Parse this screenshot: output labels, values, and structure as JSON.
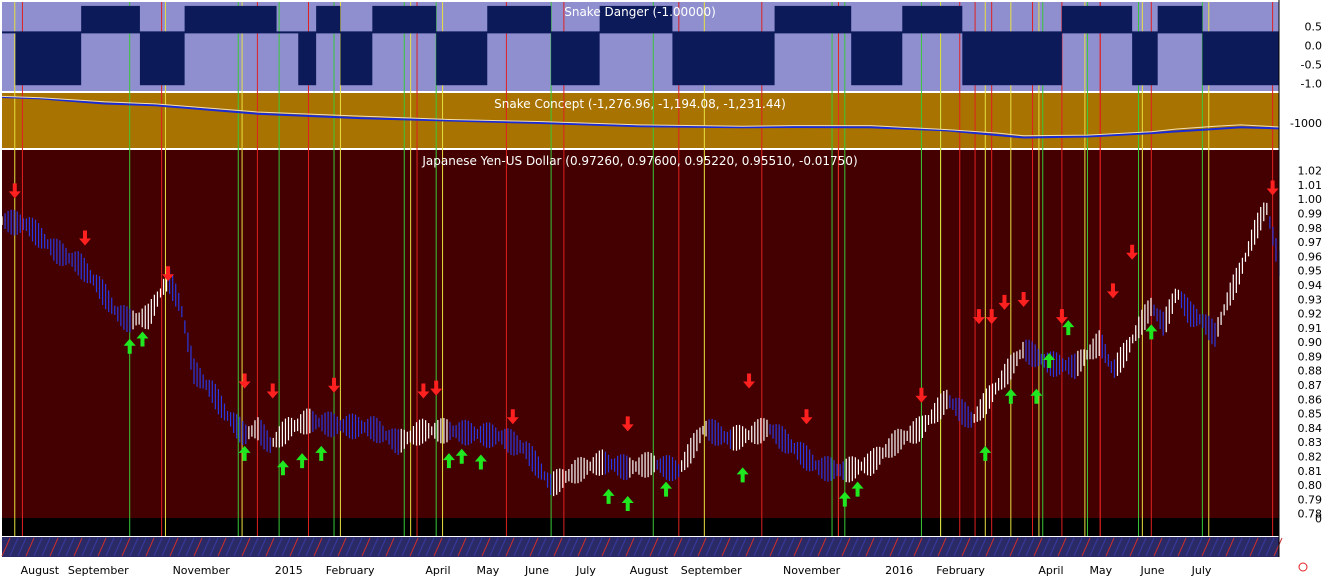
{
  "colors": {
    "danger_bg": "#8f8fd0",
    "danger_dark": "#0c1a5a",
    "concept_bg": "#a87300",
    "concept_line": "#1a2bd6",
    "concept_line2": "#f4e0b0",
    "price_bg": "#440000",
    "price_up": "#ffffff",
    "price_mid": "#2a38e0",
    "vline_green": "#38c838",
    "vline_yellow": "#e8e040",
    "vline_red": "#e02020",
    "arrow_up": "#20e820",
    "arrow_down": "#ff2020"
  },
  "chart_data": [
    {
      "type": "line",
      "title": "Snake Danger (-1.00000)",
      "ylim": [
        -1.15,
        1.1
      ],
      "ticks": [
        "0.5",
        "0.0",
        "-0.5",
        "-1.0"
      ],
      "tick_values": [
        0.5,
        0.0,
        -0.5,
        -1.0
      ],
      "states": [
        {
          "from": 0.0,
          "to": 0.0105,
          "value": 0
        },
        {
          "from": 0.0105,
          "to": 0.062,
          "value": -1
        },
        {
          "from": 0.062,
          "to": 0.108,
          "value": 1
        },
        {
          "from": 0.108,
          "to": 0.143,
          "value": -1
        },
        {
          "from": 0.143,
          "to": 0.215,
          "value": 1
        },
        {
          "from": 0.215,
          "to": 0.232,
          "value": 0
        },
        {
          "from": 0.232,
          "to": 0.246,
          "value": -1
        },
        {
          "from": 0.246,
          "to": 0.265,
          "value": 1
        },
        {
          "from": 0.265,
          "to": 0.29,
          "value": -1
        },
        {
          "from": 0.29,
          "to": 0.34,
          "value": 1
        },
        {
          "from": 0.34,
          "to": 0.38,
          "value": -1
        },
        {
          "from": 0.38,
          "to": 0.43,
          "value": 1
        },
        {
          "from": 0.43,
          "to": 0.468,
          "value": -1
        },
        {
          "from": 0.468,
          "to": 0.525,
          "value": 1
        },
        {
          "from": 0.525,
          "to": 0.605,
          "value": -1
        },
        {
          "from": 0.605,
          "to": 0.665,
          "value": 1
        },
        {
          "from": 0.665,
          "to": 0.705,
          "value": -1
        },
        {
          "from": 0.705,
          "to": 0.752,
          "value": 1
        },
        {
          "from": 0.752,
          "to": 0.83,
          "value": -1
        },
        {
          "from": 0.83,
          "to": 0.885,
          "value": 1
        },
        {
          "from": 0.885,
          "to": 0.905,
          "value": -1
        },
        {
          "from": 0.905,
          "to": 0.94,
          "value": 1
        },
        {
          "from": 0.94,
          "to": 1.0,
          "value": -1
        }
      ]
    },
    {
      "type": "line",
      "title": "Snake Concept (-1,276.96, -1,194.08, -1,231.44)",
      "ylim": [
        -1300,
        -1150
      ],
      "ticks": [
        "-1000"
      ],
      "tick_values": [
        -1232
      ],
      "x": [
        0,
        0.03,
        0.08,
        0.12,
        0.2,
        0.28,
        0.35,
        0.42,
        0.5,
        0.58,
        0.62,
        0.68,
        0.74,
        0.78,
        0.8,
        0.85,
        0.9,
        0.92,
        0.95,
        0.97,
        1.0
      ],
      "series": [
        {
          "values": [
            -1156,
            -1160,
            -1175,
            -1180,
            -1205,
            -1218,
            -1225,
            -1232,
            -1242,
            -1245,
            -1244,
            -1245,
            -1254,
            -1268,
            -1275,
            -1272,
            -1262,
            -1257,
            -1250,
            -1245,
            -1248
          ]
        },
        {
          "values": [
            -1154,
            -1158,
            -1170,
            -1176,
            -1200,
            -1212,
            -1222,
            -1228,
            -1238,
            -1242,
            -1240,
            -1240,
            -1252,
            -1262,
            -1270,
            -1268,
            -1258,
            -1250,
            -1242,
            -1238,
            -1244
          ]
        }
      ]
    },
    {
      "type": "line",
      "title": "Japanese Yen-US Dollar (0.97260, 0.97600, 0.95220, 0.95510, -0.01750)",
      "ylim": [
        0.77,
        1.026
      ],
      "ticks": [
        "1.02",
        "1.01",
        "1.00",
        "0.99",
        "0.98",
        "0.97",
        "0.96",
        "0.95",
        "0.94",
        "0.93",
        "0.92",
        "0.91",
        "0.90",
        "0.89",
        "0.88",
        "0.87",
        "0.86",
        "0.85",
        "0.84",
        "0.83",
        "0.82",
        "0.81",
        "0.80",
        "00.79",
        "0.78",
        "0"
      ],
      "tick_labels": [
        "1.02",
        "1.01",
        "1.00",
        "0.99",
        "0.98",
        "0.97",
        "0.96",
        "0.95",
        "0.94",
        "0.93",
        "0.92",
        "0.91",
        "0.90",
        "0.89",
        "0.88",
        "0.87",
        "0.86",
        "0.85",
        "0.84",
        "0.83",
        "0.82",
        "0.81",
        "0.80",
        "0.79",
        "0.78",
        "0"
      ],
      "x": [
        0,
        0.02,
        0.04,
        0.06,
        0.075,
        0.09,
        0.1,
        0.115,
        0.13,
        0.14,
        0.15,
        0.165,
        0.175,
        0.19,
        0.2,
        0.21,
        0.225,
        0.24,
        0.26,
        0.29,
        0.31,
        0.33,
        0.35,
        0.37,
        0.39,
        0.41,
        0.43,
        0.45,
        0.47,
        0.49,
        0.51,
        0.53,
        0.55,
        0.57,
        0.585,
        0.6,
        0.62,
        0.64,
        0.66,
        0.68,
        0.7,
        0.72,
        0.74,
        0.76,
        0.78,
        0.8,
        0.82,
        0.84,
        0.86,
        0.87,
        0.88,
        0.89,
        0.9,
        0.91,
        0.92,
        0.93,
        0.94,
        0.95,
        0.96,
        0.97,
        0.98,
        0.99,
        1.0
      ],
      "values": [
        0.985,
        0.982,
        0.965,
        0.955,
        0.94,
        0.92,
        0.915,
        0.918,
        0.945,
        0.925,
        0.88,
        0.865,
        0.85,
        0.835,
        0.84,
        0.828,
        0.84,
        0.845,
        0.842,
        0.84,
        0.83,
        0.838,
        0.838,
        0.836,
        0.834,
        0.825,
        0.8,
        0.81,
        0.816,
        0.812,
        0.815,
        0.81,
        0.84,
        0.832,
        0.835,
        0.84,
        0.826,
        0.812,
        0.81,
        0.815,
        0.83,
        0.84,
        0.86,
        0.845,
        0.87,
        0.895,
        0.885,
        0.883,
        0.9,
        0.88,
        0.893,
        0.91,
        0.925,
        0.912,
        0.935,
        0.92,
        0.915,
        0.905,
        0.93,
        0.95,
        0.975,
        0.995,
        0.955
      ],
      "signals_up": [
        0.1,
        0.11,
        0.19,
        0.22,
        0.235,
        0.25,
        0.35,
        0.36,
        0.375,
        0.475,
        0.49,
        0.52,
        0.58,
        0.66,
        0.67,
        0.77,
        0.79,
        0.81,
        0.82,
        0.835,
        0.9
      ],
      "signals_up_vals": [
        0.915,
        0.92,
        0.84,
        0.83,
        0.835,
        0.84,
        0.835,
        0.838,
        0.834,
        0.81,
        0.805,
        0.815,
        0.825,
        0.808,
        0.815,
        0.84,
        0.88,
        0.88,
        0.905,
        0.928,
        0.925
      ],
      "signals_down": [
        0.01,
        0.065,
        0.13,
        0.19,
        0.212,
        0.26,
        0.33,
        0.34,
        0.4,
        0.49,
        0.585,
        0.63,
        0.72,
        0.765,
        0.775,
        0.785,
        0.8,
        0.83,
        0.87,
        0.885,
        0.995
      ],
      "signals_down_vals": [
        0.988,
        0.955,
        0.93,
        0.855,
        0.848,
        0.852,
        0.848,
        0.85,
        0.83,
        0.825,
        0.855,
        0.83,
        0.845,
        0.9,
        0.9,
        0.91,
        0.912,
        0.9,
        0.918,
        0.945,
        0.99
      ]
    }
  ],
  "vlines": {
    "green": [
      0.1,
      0.185,
      0.217,
      0.26,
      0.315,
      0.34,
      0.43,
      0.51,
      0.65,
      0.66,
      0.72,
      0.735,
      0.815,
      0.85,
      0.89,
      0.94
    ],
    "yellow": [
      0.01,
      0.128,
      0.188,
      0.265,
      0.32,
      0.345,
      0.55,
      0.655,
      0.735,
      0.77,
      0.79,
      0.812,
      0.848,
      0.893,
      0.945
    ],
    "red": [
      0.016,
      0.125,
      0.2,
      0.24,
      0.325,
      0.395,
      0.44,
      0.53,
      0.595,
      0.655,
      0.75,
      0.762,
      0.775,
      0.807,
      0.83,
      0.86,
      0.86,
      0.9,
      0.995
    ]
  },
  "x_axis": {
    "labels": [
      "August",
      "September",
      "November",
      "2015",
      "February",
      "April",
      "May",
      "June",
      "July",
      "August",
      "September",
      "November",
      "2016",
      "February",
      "April",
      "May",
      "June",
      "July"
    ],
    "positions": [
      0.013,
      0.05,
      0.132,
      0.212,
      0.252,
      0.33,
      0.37,
      0.408,
      0.448,
      0.49,
      0.53,
      0.61,
      0.69,
      0.73,
      0.81,
      0.85,
      0.89,
      0.93
    ]
  }
}
